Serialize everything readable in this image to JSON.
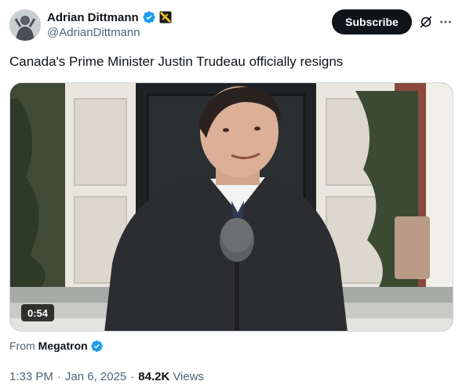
{
  "tweet": {
    "author": {
      "name": "Adrian Dittmann",
      "handle": "@AdrianDittmann"
    },
    "subscribe_label": "Subscribe",
    "text": "Canada's Prime Minister Justin Trudeau officially resigns",
    "media": {
      "duration": "0:54"
    },
    "source": {
      "prefix": "From",
      "name": "Megatron"
    },
    "meta": {
      "time": "1:33 PM",
      "separator": "·",
      "date": "Jan 6, 2025",
      "views_count": "84.2K",
      "views_label": "Views"
    }
  },
  "colors": {
    "verified_blue": "#1d9bf0",
    "subscribe_bg": "#0f1419",
    "secondary_text": "#536471"
  },
  "icons": {
    "verified": "verified-badge-icon",
    "affiliate": "affiliate-badge-icon",
    "grok": "grok-icon",
    "more": "more-options-icon"
  }
}
